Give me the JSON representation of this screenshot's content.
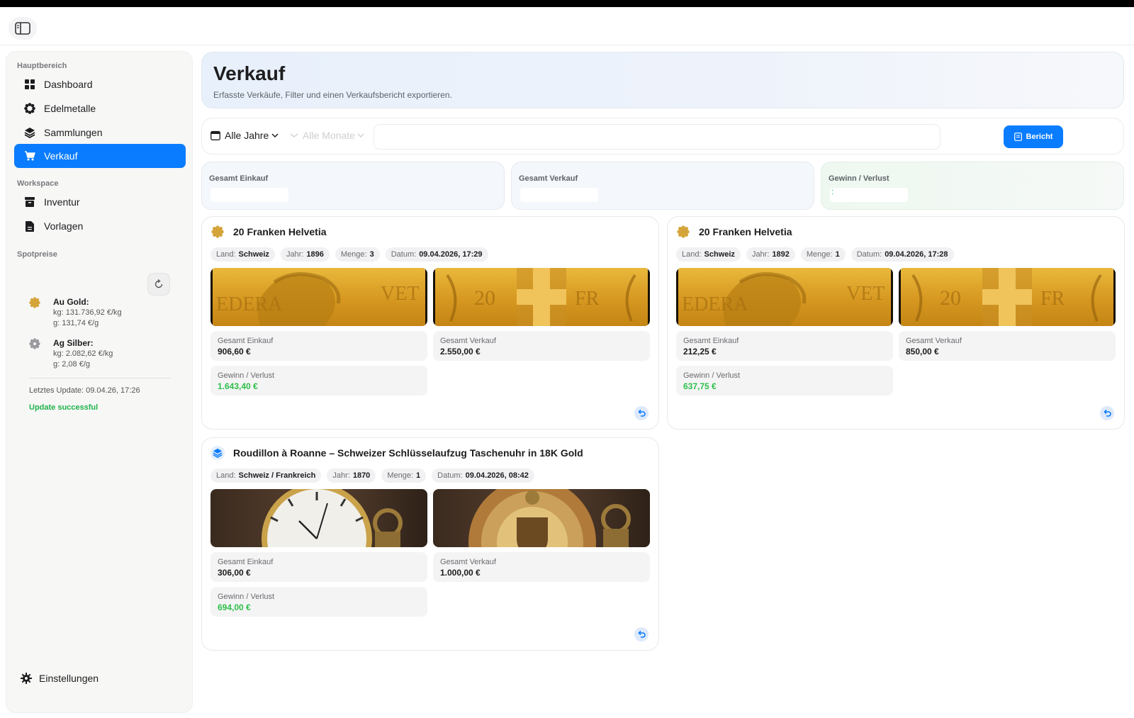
{
  "sidebar": {
    "section_main": "Hauptbereich",
    "main_items": [
      {
        "label": "Dashboard"
      },
      {
        "label": "Edelmetalle"
      },
      {
        "label": "Sammlungen"
      },
      {
        "label": "Verkauf"
      }
    ],
    "section_workspace": "Workspace",
    "workspace_items": [
      {
        "label": "Inventur"
      },
      {
        "label": "Vorlagen"
      }
    ],
    "section_spot": "Spotpreise",
    "spot": [
      {
        "name": "Au Gold:",
        "kg": "kg: 131.736,92 €/kg",
        "g": "g: 131,74 €/g",
        "color": "#d4a43a"
      },
      {
        "name": "Ag Silber:",
        "kg": "kg: 2.082,62 €/kg",
        "g": "g: 2,08 €/g",
        "color": "#9a9aa0"
      }
    ],
    "last_update": "Letztes Update: 09.04.26, 17:26",
    "update_status": "Update successful",
    "settings_label": "Einstellungen"
  },
  "header": {
    "title": "Verkauf",
    "subtitle": "Erfasste Verkäufe, Filter und einen Verkaufsbericht exportieren."
  },
  "filters": {
    "year": "Alle Jahre",
    "month": "Alle Monate",
    "report_label": "Bericht"
  },
  "summary": {
    "purchase_label": "Gesamt Einkauf",
    "sale_label": "Gesamt Verkauf",
    "profit_label": "Gewinn / Verlust",
    "profit_value": ":"
  },
  "labels": {
    "land": "Land:",
    "year": "Jahr:",
    "qty": "Menge:",
    "date": "Datum:",
    "purchase": "Gesamt Einkauf",
    "sale": "Gesamt Verkauf",
    "profit": "Gewinn / Verlust"
  },
  "sales": [
    {
      "title": "20 Franken Helvetia",
      "land": "Schweiz",
      "year": "1896",
      "qty": "3",
      "date": "09.04.2026, 17:29",
      "purchase": "906,60 €",
      "sale": "2.550,00 €",
      "profit": "1.643,40 €"
    },
    {
      "title": "20 Franken Helvetia",
      "land": "Schweiz",
      "year": "1892",
      "qty": "1",
      "date": "09.04.2026, 17:28",
      "purchase": "212,25 €",
      "sale": "850,00 €",
      "profit": "637,75 €"
    },
    {
      "title": "Roudillon à Roanne – Schweizer Schlüsselaufzug Taschenuhr in 18K Gold",
      "land": "Schweiz / Frankreich",
      "year": "1870",
      "qty": "1",
      "date": "09.04.2026, 08:42",
      "purchase": "306,00 €",
      "sale": "1.000,00 €",
      "profit": "694,00 €"
    }
  ],
  "colors": {
    "accent": "#0a7cff",
    "profit_green": "#2ebf4a",
    "gold": "#d4a43a"
  },
  "icons": {
    "dashboard": "grid-icon",
    "metals": "gear-coin-icon",
    "collections": "layers-icon",
    "sale": "cart-icon",
    "inventory": "archive-icon",
    "templates": "document-icon",
    "settings": "gear-icon"
  }
}
